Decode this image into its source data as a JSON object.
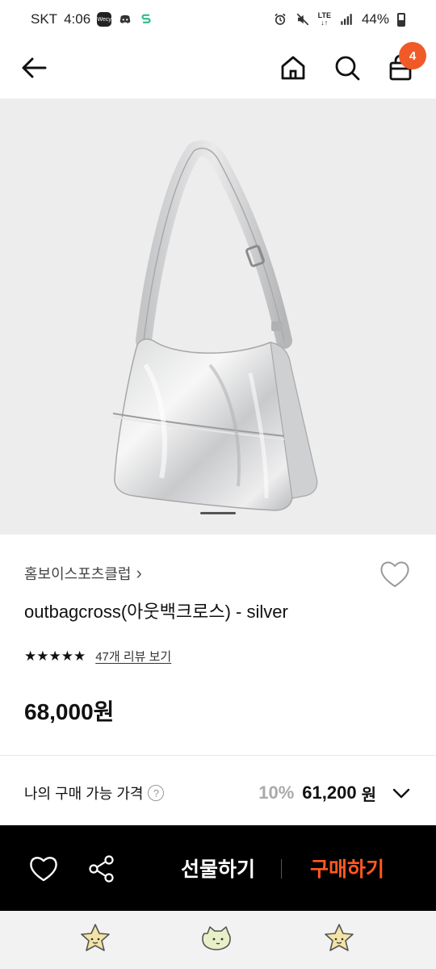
{
  "status_bar": {
    "carrier": "SKT",
    "time": "4:06",
    "app_chip": "Wecy",
    "network": "LTE",
    "battery": "44%"
  },
  "header": {
    "cart_count": "4"
  },
  "product": {
    "brand": "홈보이스포츠클럽",
    "brand_chevron": "›",
    "title": "outbagcross(아웃백크로스) - silver",
    "stars": "★★★★★",
    "review_link": "47개 리뷰 보기",
    "price": "68,000원"
  },
  "my_price": {
    "label": "나의 구매 가능 가격",
    "help_glyph": "?",
    "discount": "10%",
    "final_price": "61,200",
    "unit": "원"
  },
  "action_bar": {
    "gift_label": "선물하기",
    "buy_label": "구매하기"
  },
  "colors": {
    "accent": "#ff5a1f",
    "badge": "#f05a28",
    "action_bar_bg": "#000000",
    "image_bg": "#ededed"
  },
  "icons": [
    "back-arrow-icon",
    "home-icon",
    "search-icon",
    "shopping-bag-icon",
    "heart-icon",
    "share-icon",
    "chevron-down-icon",
    "star-mascot-icon",
    "cat-mascot-icon"
  ]
}
